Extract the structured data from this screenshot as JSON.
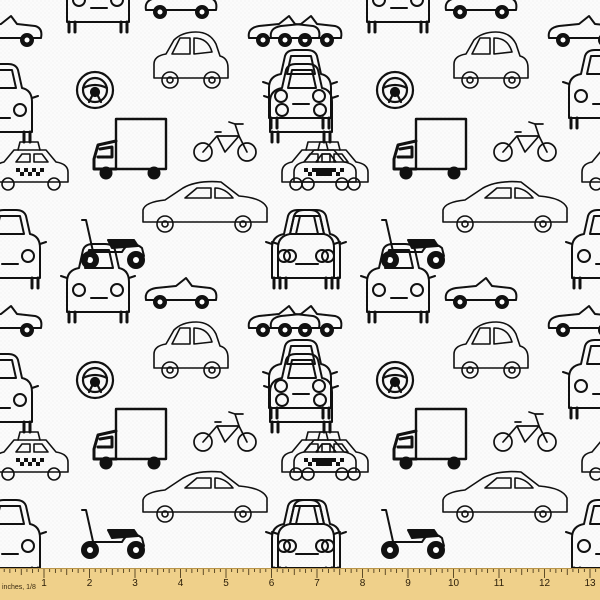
{
  "pattern": {
    "colors": {
      "background": "#fbfbfb",
      "ink": "#111111",
      "ruler": "#efd08a"
    },
    "motifs": [
      "front-car-icon",
      "convertible-icon",
      "beetle-car-icon",
      "steering-wheel-icon",
      "truck-icon",
      "bicycle-icon",
      "taxi-icon",
      "sedan-icon",
      "scooter-icon"
    ]
  },
  "ruler": {
    "unit_label": "inches, 1/8",
    "numbers": [
      "1",
      "2",
      "3",
      "4",
      "5",
      "6",
      "7",
      "8",
      "9",
      "10",
      "11",
      "12",
      "13"
    ]
  }
}
